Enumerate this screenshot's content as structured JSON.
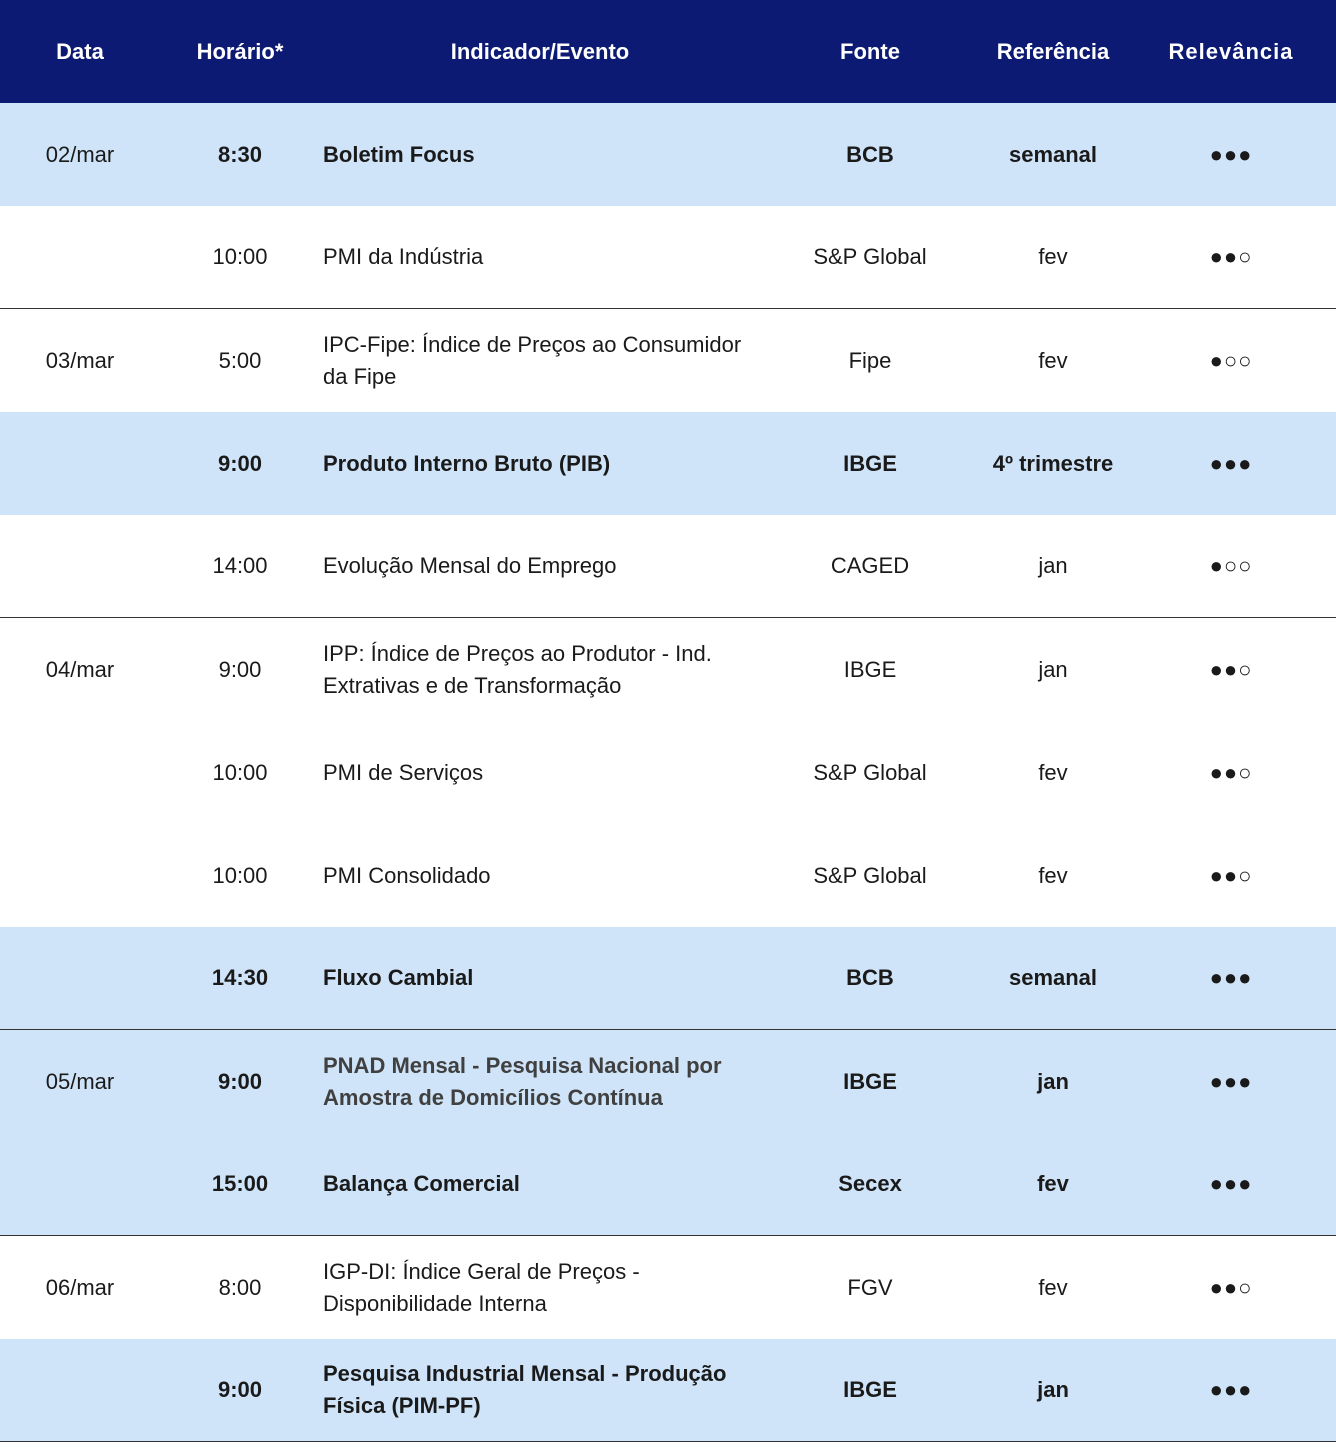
{
  "header": {
    "date": "Data",
    "time": "Horário*",
    "event": "Indicador/Evento",
    "source": "Fonte",
    "reference": "Referência",
    "relevance": "Relevância"
  },
  "rows": [
    {
      "date": "02/mar",
      "time": "8:30",
      "event": "Boletim Focus",
      "source": "BCB",
      "reference": "semanal",
      "relevance": "●●●"
    },
    {
      "date": "",
      "time": "10:00",
      "event": "PMI da Indústria",
      "source": "S&P Global",
      "reference": "fev",
      "relevance": "●●○"
    },
    {
      "date": "03/mar",
      "time": "5:00",
      "event": "IPC-Fipe: Índice de Preços ao Consumidor da Fipe",
      "source": "Fipe",
      "reference": "fev",
      "relevance": "●○○"
    },
    {
      "date": "",
      "time": "9:00",
      "event": "Produto Interno Bruto (PIB)",
      "source": "IBGE",
      "reference": "4º trimestre",
      "relevance": "●●●"
    },
    {
      "date": "",
      "time": "14:00",
      "event": "Evolução Mensal do Emprego",
      "source": "CAGED",
      "reference": "jan",
      "relevance": "●○○"
    },
    {
      "date": "04/mar",
      "time": "9:00",
      "event": "IPP: Índice de Preços ao Produtor - Ind. Extrativas e de Transformação",
      "source": "IBGE",
      "reference": "jan",
      "relevance": "●●○"
    },
    {
      "date": "",
      "time": "10:00",
      "event": "PMI de Serviços",
      "source": "S&P Global",
      "reference": "fev",
      "relevance": "●●○"
    },
    {
      "date": "",
      "time": "10:00",
      "event": "PMI Consolidado",
      "source": "S&P Global",
      "reference": "fev",
      "relevance": "●●○"
    },
    {
      "date": "",
      "time": "14:30",
      "event": "Fluxo Cambial",
      "source": "BCB",
      "reference": "semanal",
      "relevance": "●●●"
    },
    {
      "date": "05/mar",
      "time": "9:00",
      "event": "PNAD Mensal - Pesquisa Nacional por Amostra de Domicílios Contínua",
      "source": "IBGE",
      "reference": "jan",
      "relevance": "●●●"
    },
    {
      "date": "",
      "time": "15:00",
      "event": "Balança Comercial",
      "source": "Secex",
      "reference": "fev",
      "relevance": "●●●"
    },
    {
      "date": "06/mar",
      "time": "8:00",
      "event": "IGP-DI: Índice Geral de Preços - Disponibilidade Interna",
      "source": "FGV",
      "reference": "fev",
      "relevance": "●●○"
    },
    {
      "date": "",
      "time": "9:00",
      "event": "Pesquisa Industrial Mensal - Produção Física (PIM-PF)",
      "source": "IBGE",
      "reference": "jan",
      "relevance": "●●●"
    }
  ]
}
